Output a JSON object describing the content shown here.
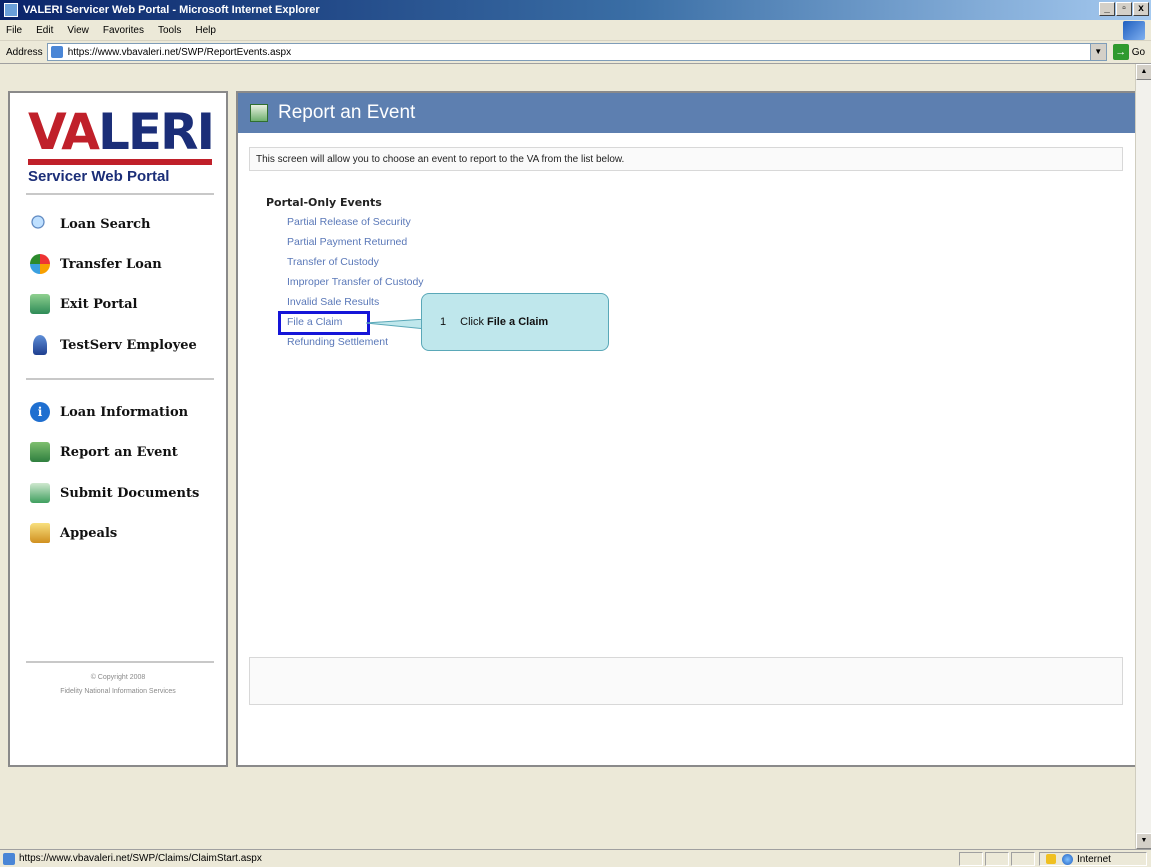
{
  "window": {
    "title": "VALERI Servicer Web Portal - Microsoft Internet Explorer",
    "minimize": "_",
    "restore": "▫",
    "close": "x"
  },
  "menubar": {
    "items": [
      "File",
      "Edit",
      "View",
      "Favorites",
      "Tools",
      "Help"
    ]
  },
  "address": {
    "label": "Address",
    "url": "https://www.vbavaleri.net/SWP/ReportEvents.aspx",
    "go": "Go"
  },
  "sidebar": {
    "logo": {
      "va": "VA",
      "rest": "LERI",
      "subtitle": "Servicer Web Portal"
    },
    "items": [
      {
        "label": "Loan Search",
        "icon": "search-icon"
      },
      {
        "label": "Transfer Loan",
        "icon": "transfer-icon"
      },
      {
        "label": "Exit Portal",
        "icon": "exit-icon"
      },
      {
        "label": "TestServ Employee",
        "icon": "user-icon"
      },
      {
        "label": "Loan Information",
        "icon": "info-icon"
      },
      {
        "label": "Report an Event",
        "icon": "report-icon"
      },
      {
        "label": "Submit Documents",
        "icon": "submit-icon"
      },
      {
        "label": "Appeals",
        "icon": "appeals-icon"
      }
    ],
    "copyright_line1": "© Copyright 2008",
    "copyright_line2": "Fidelity National Information Services"
  },
  "main": {
    "title": "Report an Event",
    "intro": "This screen will allow you to choose an event to report to the VA from the list below.",
    "section": "Portal-Only Events",
    "events": [
      "Partial Release of Security",
      "Partial Payment Returned",
      "Transfer of Custody",
      "Improper Transfer of Custody",
      "Invalid Sale Results",
      "File a Claim",
      "Refunding Settlement"
    ]
  },
  "callout": {
    "step": "1",
    "prefix": "Click ",
    "target": "File a Claim"
  },
  "statusbar": {
    "url": "https://www.vbavaleri.net/SWP/Claims/ClaimStart.aspx",
    "zone": "Internet"
  },
  "colors": {
    "header_blue": "#5d7fb0",
    "link": "#5a78b8",
    "highlight": "#1515d8",
    "callout_bg": "#bfe7ec",
    "logo_red": "#c0202a",
    "logo_navy": "#1b2e78"
  }
}
